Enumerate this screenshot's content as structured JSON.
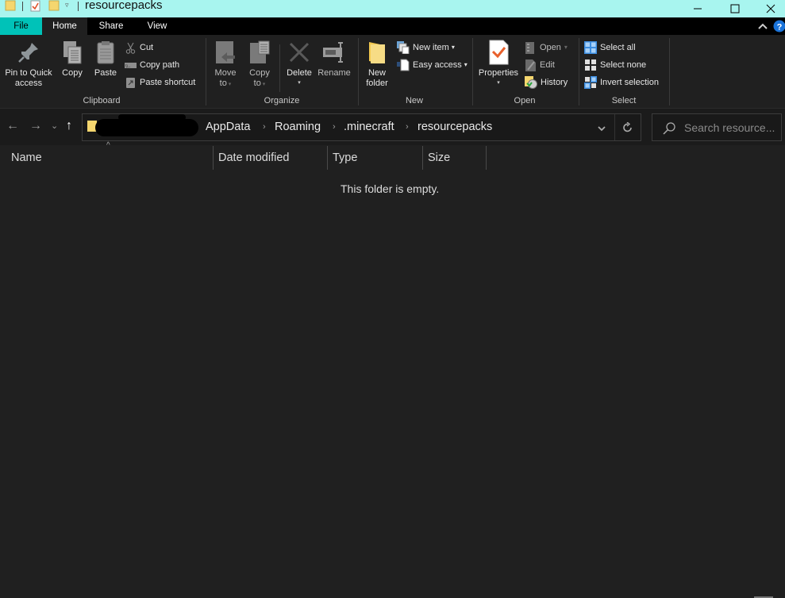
{
  "window": {
    "title": "resourcepacks",
    "controls": {
      "minimize": "—",
      "maximize": "☐",
      "close": "✕"
    }
  },
  "ribbon_tabs": [
    {
      "label": "File",
      "active": false
    },
    {
      "label": "Home",
      "active": true
    },
    {
      "label": "Share",
      "active": false
    },
    {
      "label": "View",
      "active": false
    }
  ],
  "ribbon": {
    "clipboard": {
      "label": "Clipboard",
      "pin_line1": "Pin to Quick",
      "pin_line2": "access",
      "copy": "Copy",
      "paste": "Paste",
      "cut": "Cut",
      "copy_path": "Copy path",
      "paste_shortcut": "Paste shortcut"
    },
    "organize": {
      "label": "Organize",
      "move_line1": "Move",
      "move_line2": "to",
      "copy_line1": "Copy",
      "copy_line2": "to",
      "delete": "Delete",
      "rename": "Rename"
    },
    "new": {
      "label": "New",
      "folder_line1": "New",
      "folder_line2": "folder",
      "new_item": "New item",
      "easy_access": "Easy access"
    },
    "open": {
      "label": "Open",
      "properties": "Properties",
      "open": "Open",
      "edit": "Edit",
      "history": "History"
    },
    "select": {
      "label": "Select",
      "select_all": "Select all",
      "select_none": "Select none",
      "invert": "Invert selection"
    }
  },
  "nav": {
    "back": "←",
    "forward": "→",
    "recent": "⌄",
    "up": "↑",
    "breadcrumbs": [
      "AppData",
      "Roaming",
      ".minecraft",
      "resourcepacks"
    ],
    "search_placeholder": "Search resource..."
  },
  "columns": [
    "Name",
    "Date modified",
    "Type",
    "Size"
  ],
  "empty_message": "This folder is empty.",
  "colors": {
    "titlebar": "#a8f5ef",
    "file_tab": "#00c2b8",
    "background": "#202020",
    "folder": "#f5d66e"
  }
}
